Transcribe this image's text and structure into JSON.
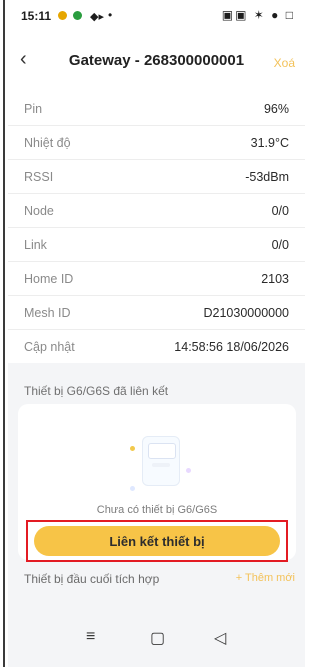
{
  "status_bar": {
    "time": "15:11",
    "extra": "•",
    "right_icons": "▣▣ ✶ ● □"
  },
  "header": {
    "back_icon": "chevron-left-icon",
    "title": "Gateway - 268300000001",
    "action": "Xoá"
  },
  "info": [
    {
      "label": "Pin",
      "value": "96%"
    },
    {
      "label": "Nhiệt độ",
      "value": "31.9°C"
    },
    {
      "label": "RSSI",
      "value": "-53dBm"
    },
    {
      "label": "Node",
      "value": "0/0"
    },
    {
      "label": "Link",
      "value": "0/0"
    },
    {
      "label": "Home ID",
      "value": "2103"
    },
    {
      "label": "Mesh ID",
      "value": "D21030000000"
    },
    {
      "label": "Cập nhật",
      "value": "14:58:56 18/06/2026"
    }
  ],
  "linked_section": {
    "title": "Thiết bị G6/G6S đã liên kết",
    "empty_text": "Chưa có thiết bị G6/G6S",
    "link_button": "Liên kết thiết bị"
  },
  "integrated_section": {
    "title": "Thiết bị đầu cuối tích hợp",
    "add_label": "+ Thêm mới"
  },
  "nav": {
    "menu_icon": "≡",
    "home_icon": "▢",
    "back_icon": "◁"
  },
  "colors": {
    "accent": "#f7c447",
    "highlight_border": "#e31b23"
  }
}
